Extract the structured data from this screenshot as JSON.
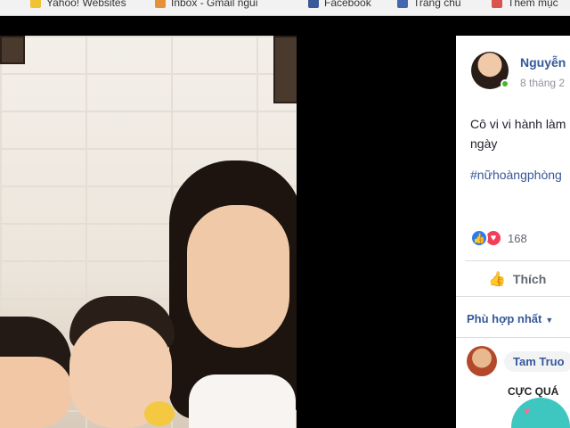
{
  "bookmarks": [
    {
      "label": "Yahoo! Websites",
      "icon": "folder-icon"
    },
    {
      "label": "Inbox - Gmail ngũi",
      "icon": "gmail-icon"
    },
    {
      "label": "Facebook",
      "icon": "facebook-icon"
    },
    {
      "label": "Trang chủ",
      "icon": "facebook-icon"
    },
    {
      "label": "Thêm mục",
      "icon": "folder-icon"
    }
  ],
  "post": {
    "author": "Nguyễn",
    "time": "8 tháng 2",
    "text": "Cô vi vi hành làm nhau suốt ngày",
    "hashtag": "#nữhoàngphòng",
    "reaction_count": "168",
    "like_label": "Thích"
  },
  "comments": {
    "sort_label": "Phù hợp nhất",
    "first_commenter": "Tam Truo",
    "sticker_text": "CỰC QUÁ"
  },
  "colors": {
    "facebook_blue": "#365899",
    "like_blue": "#2b7bf0",
    "love_red": "#f33e58",
    "online_green": "#42b72a"
  }
}
